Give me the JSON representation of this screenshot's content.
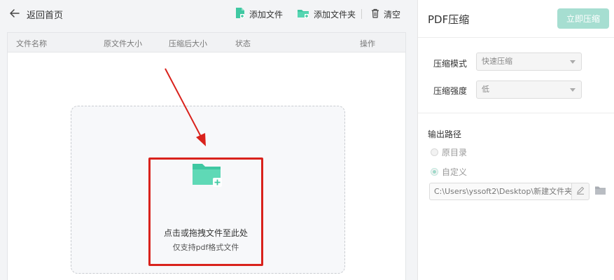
{
  "topbar": {
    "back_label": "返回首页",
    "add_file_label": "添加文件",
    "add_folder_label": "添加文件夹",
    "clear_label": "清空"
  },
  "table": {
    "columns": [
      "文件名称",
      "原文件大小",
      "压缩后大小",
      "状态",
      "操作"
    ]
  },
  "dropzone": {
    "title": "点击或拖拽文件至此处",
    "subtitle": "仅支持pdf格式文件"
  },
  "panel": {
    "title": "PDF压缩",
    "compress_button": "立即压缩",
    "mode_label": "压缩模式",
    "mode_value": "快速压缩",
    "strength_label": "压缩强度",
    "strength_value": "低",
    "output_title": "输出路径",
    "option_original": "原目录",
    "option_custom": "自定义",
    "output_path": "C:\\Users\\yssoft2\\Desktop\\新建文件夹"
  },
  "colors": {
    "accent": "#a6ded1",
    "icon_green": "#3fc8a2",
    "highlight_red": "#d9221c"
  },
  "icons": [
    "arrow-left-icon",
    "add-file-icon",
    "add-folder-icon",
    "trash-icon",
    "folder-plus-icon",
    "edit-icon",
    "folder-icon"
  ]
}
